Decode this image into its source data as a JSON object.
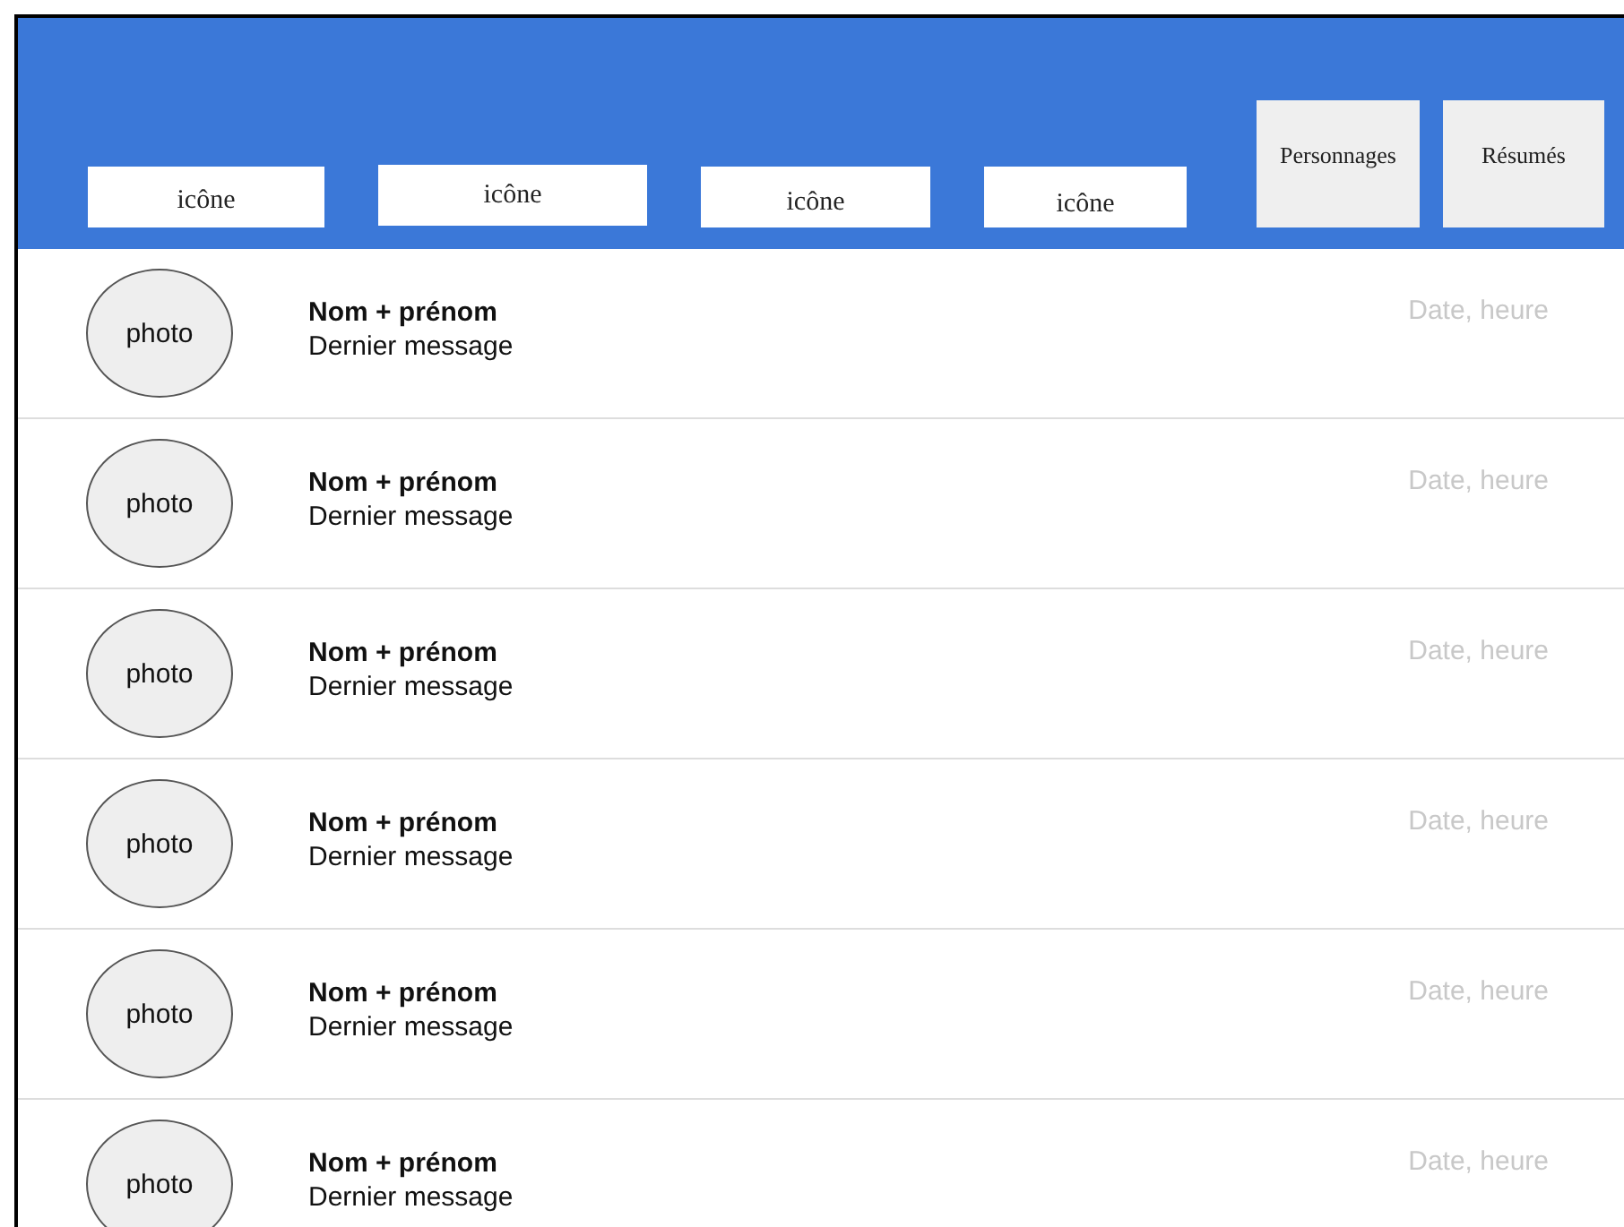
{
  "header": {
    "icon_buttons": [
      "icône",
      "icône",
      "icône",
      "icône"
    ],
    "nav_buttons": [
      "Personnages",
      "Résumés"
    ]
  },
  "conversations": [
    {
      "photo": "photo",
      "name": "Nom + prénom",
      "message": "Dernier message",
      "date": "Date, heure"
    },
    {
      "photo": "photo",
      "name": "Nom + prénom",
      "message": "Dernier message",
      "date": "Date, heure"
    },
    {
      "photo": "photo",
      "name": "Nom + prénom",
      "message": "Dernier message",
      "date": "Date, heure"
    },
    {
      "photo": "photo",
      "name": "Nom + prénom",
      "message": "Dernier message",
      "date": "Date, heure"
    },
    {
      "photo": "photo",
      "name": "Nom + prénom",
      "message": "Dernier message",
      "date": "Date, heure"
    },
    {
      "photo": "photo",
      "name": "Nom + prénom",
      "message": "Dernier message",
      "date": "Date, heure"
    }
  ]
}
